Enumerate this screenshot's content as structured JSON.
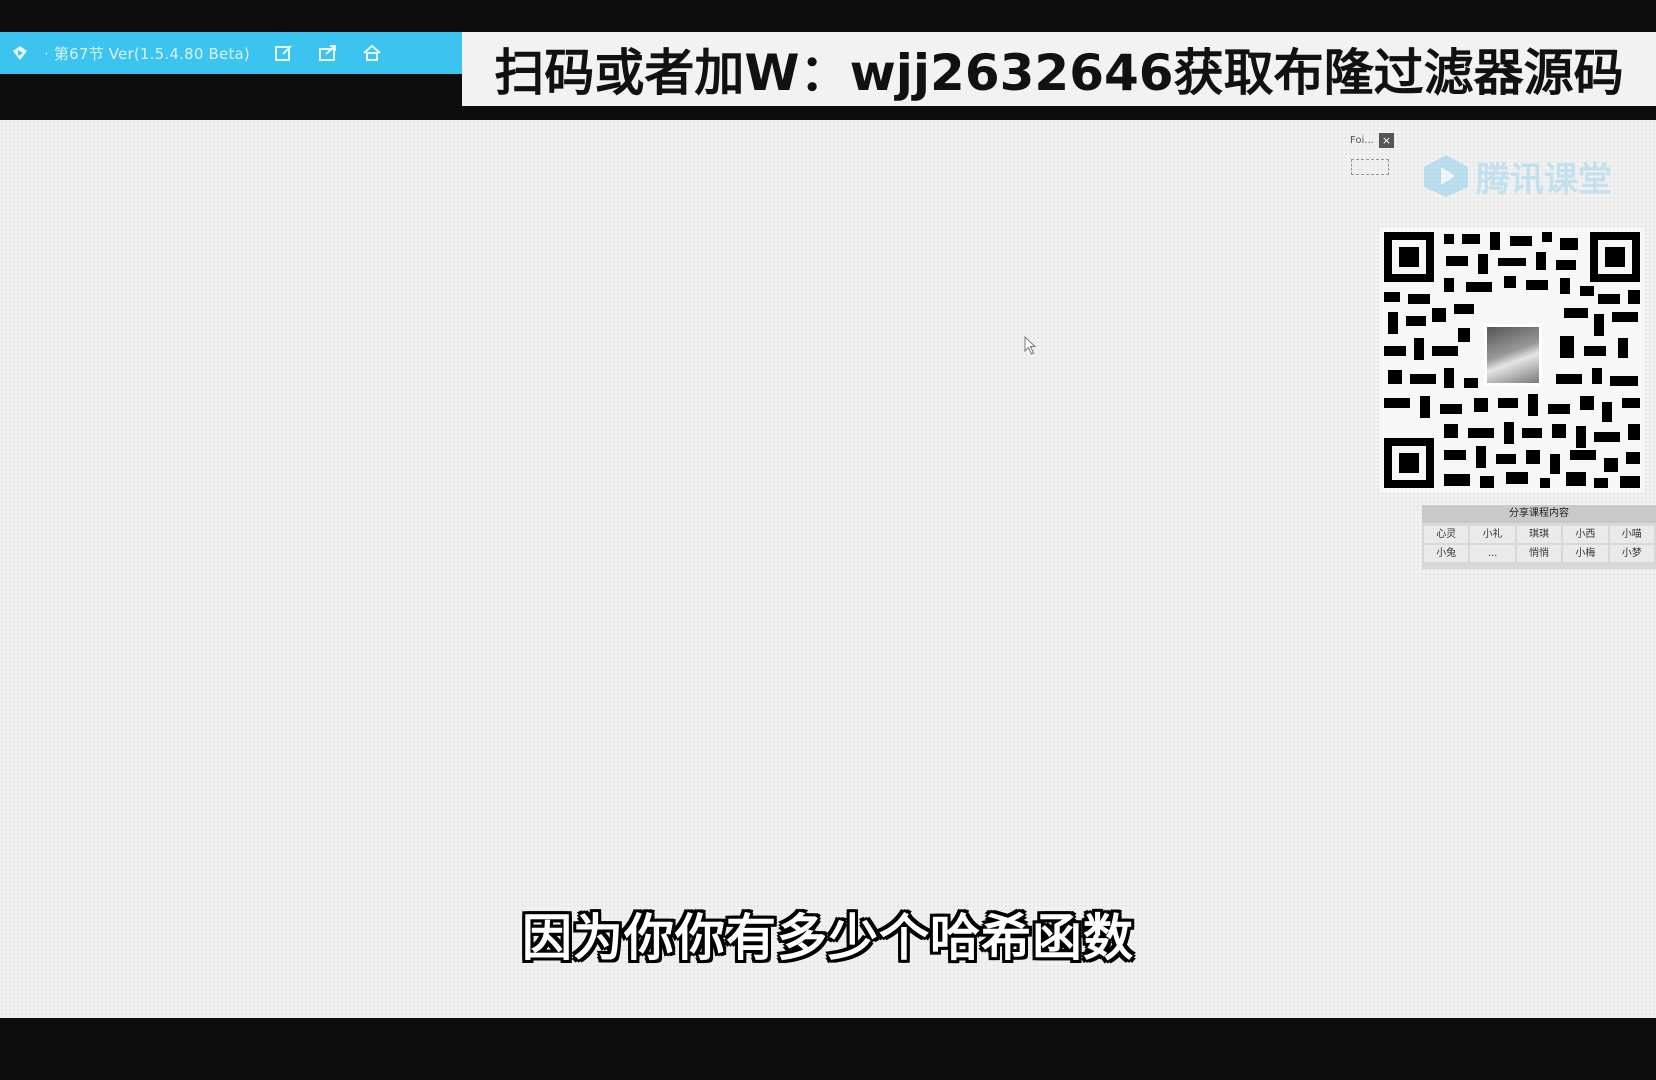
{
  "lesson_bar": {
    "title": "· 第67节 Ver(1.5.4.80 Beta)",
    "icons": [
      "app-logo-icon",
      "edit-icon",
      "share-icon",
      "home-icon"
    ],
    "background": "#3dc3ef"
  },
  "banner": {
    "text": "扫码或者加W：wjj2632646获取布隆过滤器源码"
  },
  "mini_widget": {
    "title": "Foi...",
    "close": "×"
  },
  "watermark": {
    "text": "腾讯课堂"
  },
  "small_panel": {
    "header": "分享课程内容",
    "cells": [
      "心灵",
      "小礼",
      "琪琪",
      "小西",
      "小喵",
      "小兔",
      "...",
      "悄悄",
      "小梅",
      "小梦"
    ]
  },
  "subtitle": "因为你你有多少个哈希函数"
}
